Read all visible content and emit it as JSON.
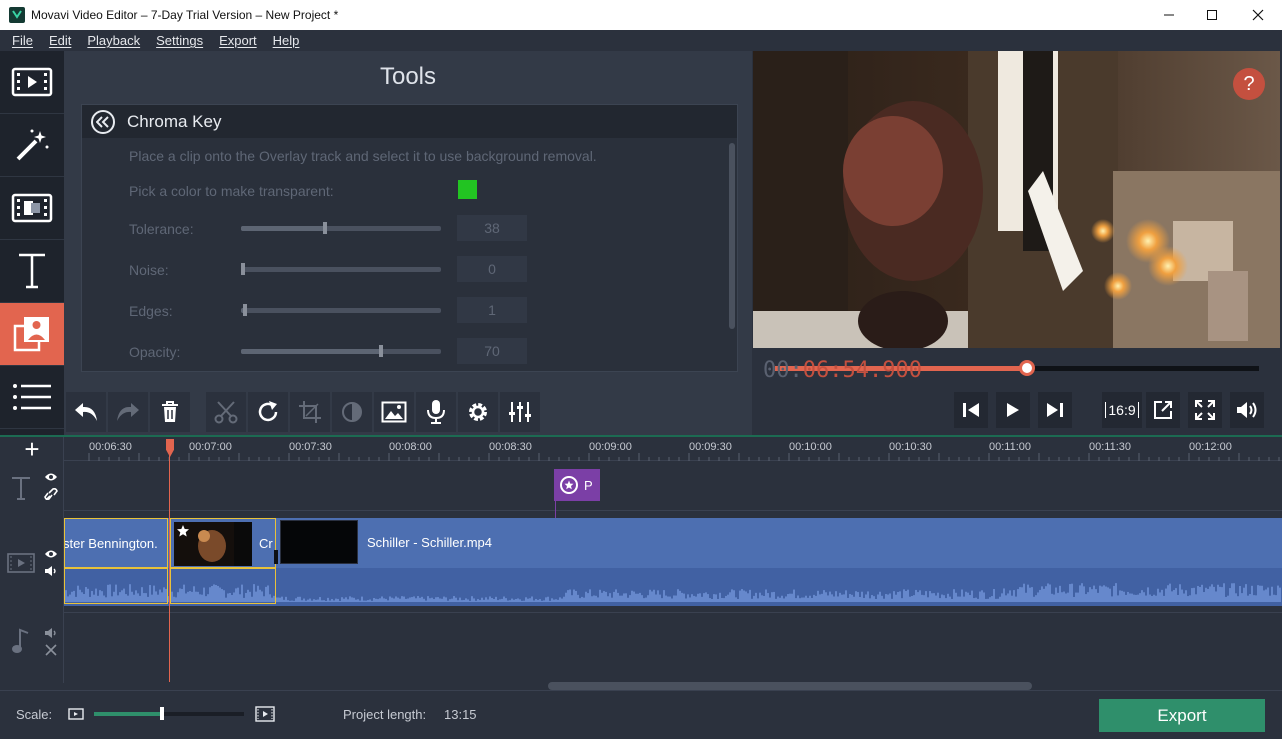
{
  "window": {
    "title": "Movavi Video Editor – 7-Day Trial Version – New Project *",
    "controls": [
      "minimize-icon",
      "maximize-icon",
      "close-icon"
    ]
  },
  "menu": {
    "items": [
      "File",
      "Edit",
      "Playback",
      "Settings",
      "Export",
      "Help"
    ]
  },
  "sidebar": {
    "items": [
      {
        "icon": "import-film-icon",
        "active": false
      },
      {
        "icon": "magic-wand-icon",
        "active": false
      },
      {
        "icon": "transitions-icon",
        "active": false
      },
      {
        "icon": "titles-icon",
        "active": false
      },
      {
        "icon": "chroma-key-icon",
        "active": true
      },
      {
        "icon": "more-tools-icon",
        "active": false
      }
    ]
  },
  "tools": {
    "title": "Tools",
    "panel_title": "Chroma Key",
    "hint": "Place a clip onto the Overlay track and select it to use background removal.",
    "pick_color_label": "Pick a color to make transparent:",
    "picked_color": "#22c422",
    "params": [
      {
        "label": "Tolerance:",
        "value": "38",
        "level": 0.42
      },
      {
        "label": "Noise:",
        "value": "0",
        "level": 0.0
      },
      {
        "label": "Edges:",
        "value": "1",
        "level": 0.02
      },
      {
        "label": "Opacity:",
        "value": "70",
        "level": 0.7
      }
    ]
  },
  "preview": {
    "help_label": "?",
    "progress": 0.52
  },
  "player": {
    "timecode_dim": "00:",
    "timecode_lit": "06:54.900",
    "aspect_label": "16:9"
  },
  "toolbar": {
    "buttons": [
      "undo-icon",
      "redo-icon",
      "delete-icon",
      "cut-icon",
      "rotate-icon",
      "crop-icon",
      "color-adjust-icon",
      "image-icon",
      "microphone-icon",
      "settings-icon",
      "equalizer-icon"
    ]
  },
  "timeline": {
    "add_label": "+",
    "ticks": [
      "00:06:30",
      "00:07:00",
      "00:07:30",
      "00:08:00",
      "00:08:30",
      "00:09:00",
      "00:09:30",
      "00:10:00",
      "00:10:30",
      "00:11:00",
      "00:11:30",
      "00:12:00"
    ],
    "title_clip_label": "P",
    "clip1_label": "ster Bennington.",
    "clip2_label": "Cr",
    "clip3_label": "Schiller - Schiller.mp4"
  },
  "footer": {
    "scale_label": "Scale:",
    "scale_level": 0.45,
    "project_length_label": "Project length:",
    "project_length_value": "13:15",
    "export_label": "Export"
  },
  "colors": {
    "accent": "#e2654f",
    "export_green": "#2f8f6b",
    "clip_blue": "#4d6fb1",
    "selection_yellow": "#e8c23a",
    "title_purple": "#7b3fa6"
  }
}
